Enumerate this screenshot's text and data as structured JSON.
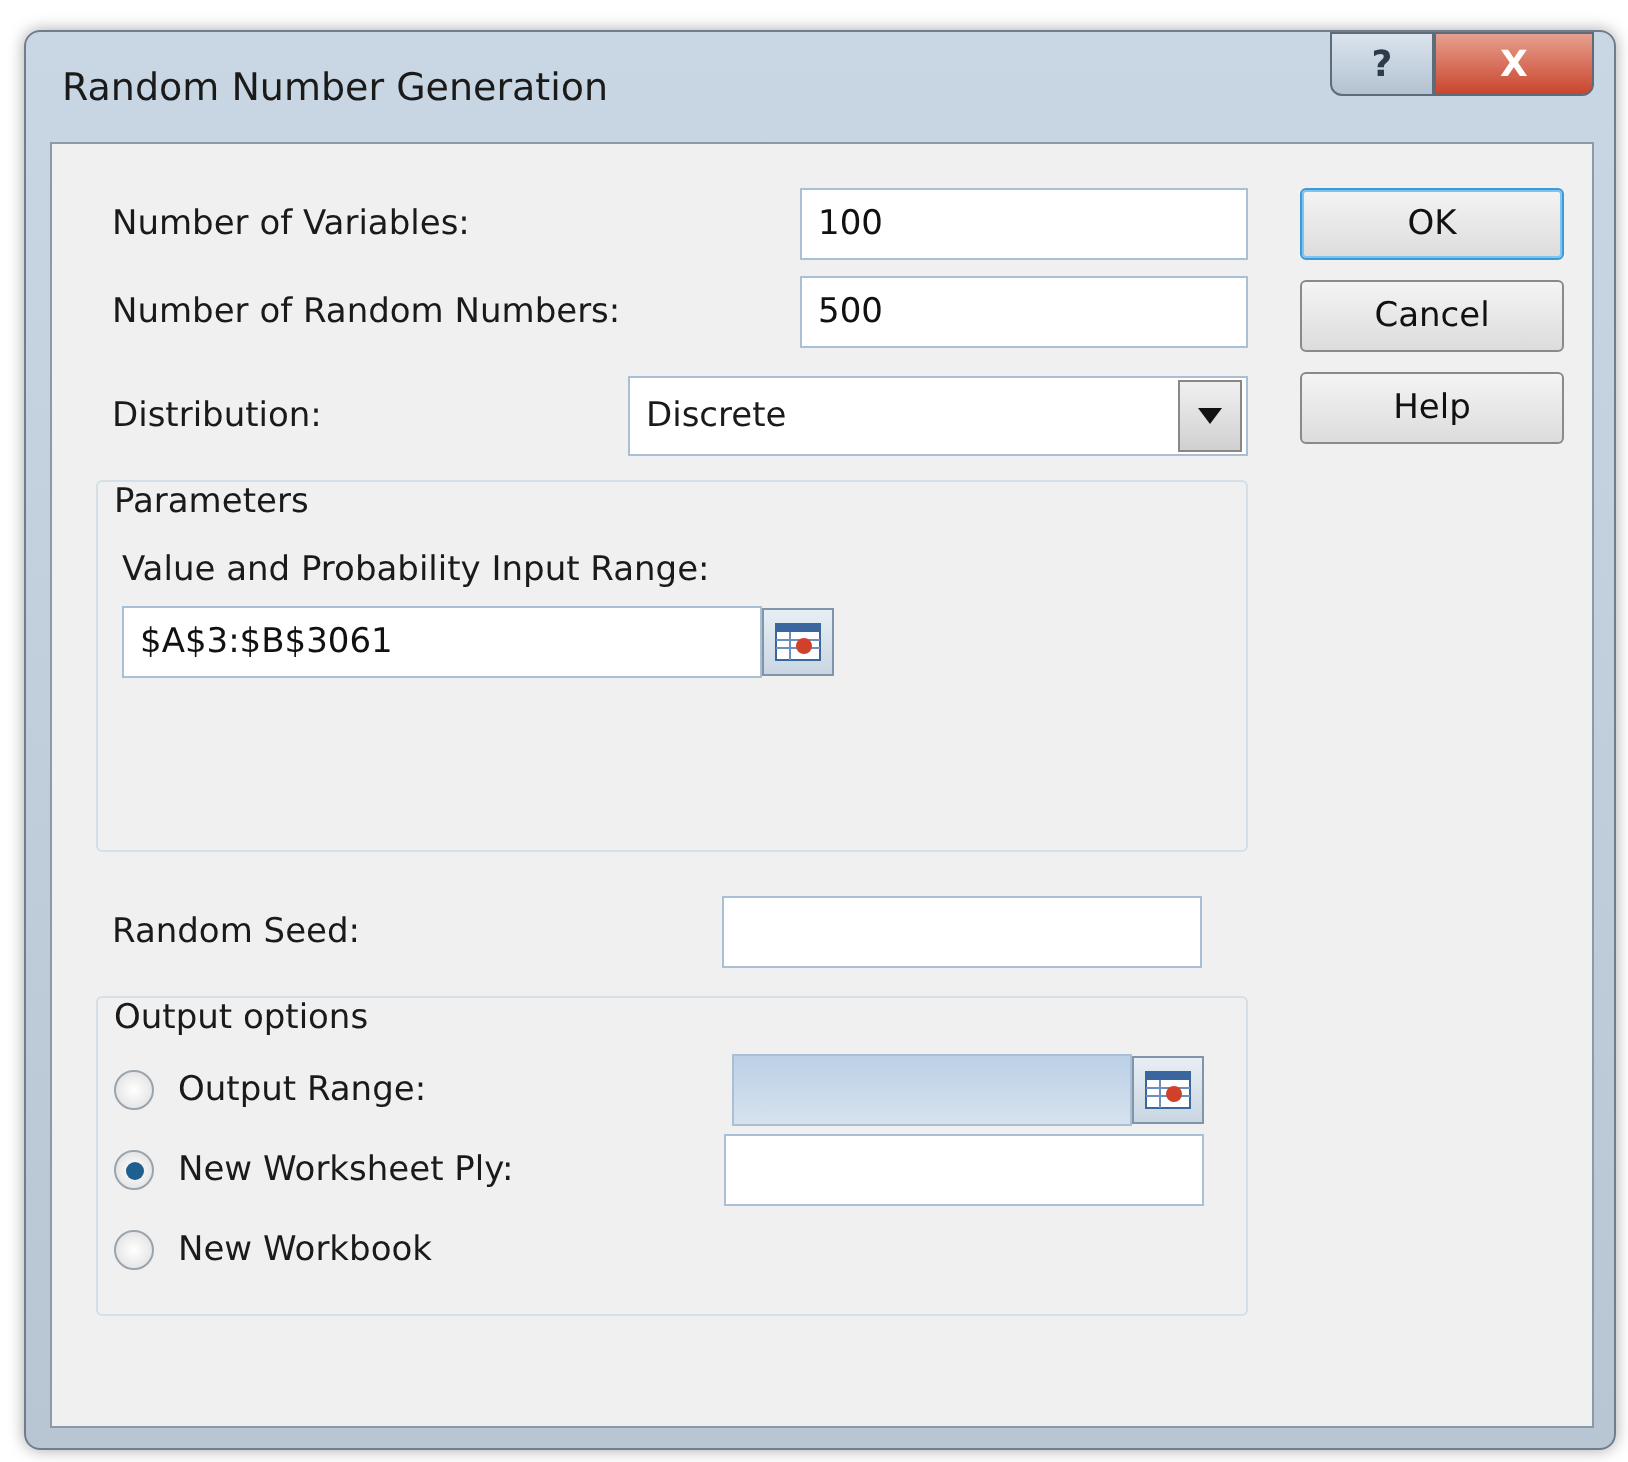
{
  "window": {
    "title": "Random Number Generation",
    "controls": [
      {
        "kind": "help",
        "label": "?"
      },
      {
        "kind": "close",
        "label": "X"
      }
    ]
  },
  "fields": [
    {
      "label": "Number of Variables:",
      "value": "100"
    },
    {
      "label": "Number of Random Numbers:",
      "value": "500"
    }
  ],
  "distribution": {
    "label": "Distribution:",
    "value": "Discrete"
  },
  "parameters": {
    "title": "Parameters",
    "input_range": {
      "label": "Value and Probability Input Range:",
      "value": "$A$3:$B$3061"
    }
  },
  "random_seed": {
    "label": "Random Seed:"
  },
  "output_options": {
    "title": "Output options",
    "options": [
      {
        "label": "Output Range:",
        "selected": false,
        "kind": "range",
        "disabled": true
      },
      {
        "label": "New Worksheet Ply:",
        "selected": true,
        "kind": "field"
      },
      {
        "label": "New Workbook",
        "selected": false,
        "kind": "none"
      }
    ]
  },
  "buttons": [
    {
      "label": "OK",
      "default": true
    },
    {
      "label": "Cancel",
      "default": false
    },
    {
      "label": "Help",
      "default": false
    }
  ]
}
